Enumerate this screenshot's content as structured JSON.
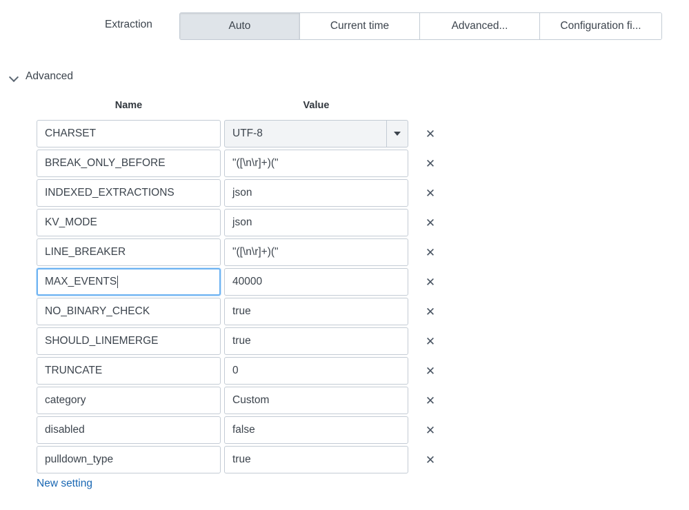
{
  "extraction": {
    "label": "Extraction",
    "tabs": [
      {
        "label": "Auto",
        "selected": true
      },
      {
        "label": "Current time",
        "selected": false
      },
      {
        "label": "Advanced...",
        "selected": false
      },
      {
        "label": "Configuration fi...",
        "selected": false
      }
    ]
  },
  "advanced": {
    "title": "Advanced",
    "chevron_icon": "chevron-down-icon",
    "expanded": true,
    "columns": {
      "name": "Name",
      "value": "Value"
    },
    "new_setting_label": "New setting",
    "remove_icon": "close-icon",
    "rows": [
      {
        "name": "CHARSET",
        "value": "UTF-8",
        "type": "dropdown",
        "focused": false
      },
      {
        "name": "BREAK_ONLY_BEFORE",
        "value": "\"([\\n\\r]+)(\"",
        "type": "text",
        "focused": false
      },
      {
        "name": "INDEXED_EXTRACTIONS",
        "value": "json",
        "type": "text",
        "focused": false
      },
      {
        "name": "KV_MODE",
        "value": "json",
        "type": "text",
        "focused": false
      },
      {
        "name": "LINE_BREAKER",
        "value": "\"([\\n\\r]+)(\"",
        "type": "text",
        "focused": false
      },
      {
        "name": "MAX_EVENTS",
        "value": "40000",
        "type": "text",
        "focused": true
      },
      {
        "name": "NO_BINARY_CHECK",
        "value": "true",
        "type": "text",
        "focused": false
      },
      {
        "name": "SHOULD_LINEMERGE",
        "value": "true",
        "type": "text",
        "focused": false
      },
      {
        "name": "TRUNCATE",
        "value": "0",
        "type": "text",
        "focused": false
      },
      {
        "name": "category",
        "value": "Custom",
        "type": "text",
        "focused": false
      },
      {
        "name": "disabled",
        "value": "false",
        "type": "text",
        "focused": false
      },
      {
        "name": "pulldown_type",
        "value": "true",
        "type": "text",
        "focused": false
      }
    ]
  },
  "colors": {
    "border": "#c3cbd4",
    "text": "#3c444d",
    "link": "#1967b3",
    "tab_selected_bg": "#dfe4e9",
    "focus_border": "#6db3f2"
  }
}
